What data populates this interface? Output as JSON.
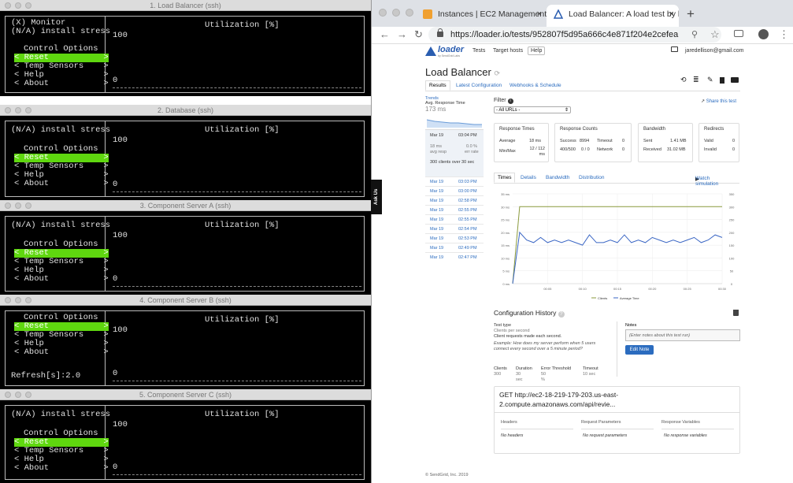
{
  "terminals": [
    {
      "title": "1. Load Balancer (ssh)",
      "lines": [
        "(X) Monitor",
        "(N/A) install stress"
      ],
      "util_header": "Utilization [%]",
      "top": "100",
      "bottom": "0",
      "refresh": "",
      "controls": {
        "header": "Control Options",
        "reset": "< Reset           >",
        "temp": "< Temp Sensors    >",
        "help": "< Help            >",
        "about": "< About           >"
      }
    },
    {
      "title": "2. Database (ssh)",
      "lines": [
        "(N/A) install stress"
      ],
      "util_header": "Utilization [%]",
      "top": "100",
      "bottom": "0",
      "refresh": "",
      "controls": {
        "header": "Control Options",
        "reset": "< Reset           >",
        "temp": "< Temp Sensors    >",
        "help": "< Help            >",
        "about": "< About           >"
      }
    },
    {
      "title": "3. Component Server A (ssh)",
      "lines": [
        "(N/A) install stress"
      ],
      "util_header": "Utilization [%]",
      "top": "100",
      "bottom": "0",
      "refresh": "",
      "controls": {
        "header": "Control Options",
        "reset": "< Reset           >",
        "temp": "< Temp Sensors    >",
        "help": "< Help            >",
        "about": "< About           >"
      }
    },
    {
      "title": "4. Component Server B (ssh)",
      "lines": [],
      "util_header": "Utilization [%]",
      "top": "100",
      "bottom": "0",
      "refresh": "Refresh[s]:2.0",
      "controls": {
        "header": "Control Options",
        "reset": "< Reset           >",
        "temp": "< Temp Sensors    >",
        "help": "< Help            >",
        "about": "< About           >"
      }
    },
    {
      "title": "5. Component Server C (ssh)",
      "lines": [
        "(N/A) install stress"
      ],
      "util_header": "Utilization [%]",
      "top": "100",
      "bottom": "0",
      "refresh": "",
      "controls": {
        "header": "Control Options",
        "reset": "< Reset           >",
        "temp": "< Temp Sensors    >",
        "help": "< Help            >",
        "about": "< About           >"
      }
    }
  ],
  "browser": {
    "tabs": [
      {
        "label": "Instances | EC2 Management C",
        "close": "×"
      },
      {
        "label": "Load Balancer: A load test by l",
        "close": "×"
      }
    ],
    "new_tab": "+",
    "url": "https://loader.io/tests/952807f5d95a666c4e871f204e2cefea"
  },
  "page": {
    "logo": "loader",
    "logo_sub": "by SendGrid Labs",
    "nav": [
      "Tests",
      "Target hosts"
    ],
    "help": "Help",
    "account": "jaredellison@gmail.com",
    "title": "Load Balancer",
    "tabs": [
      "Results",
      "Latest Configuration",
      "Webhooks & Schedule"
    ],
    "trends_label": "Trends",
    "trends_metric": "Avg. Response Time",
    "trends_value": "173 ms",
    "current_run": {
      "date": "Mar 19",
      "time": "03:04 PM",
      "avg": "18 ms",
      "avg_label": "avg resp",
      "err": "0.0 %",
      "err_label": "err rate",
      "clients": "300 clients over 30 sec"
    },
    "runs": [
      [
        "Mar 19",
        "03:03 PM"
      ],
      [
        "Mar 19",
        "03:00 PM"
      ],
      [
        "Mar 19",
        "02:58 PM"
      ],
      [
        "Mar 19",
        "02:55 PM"
      ],
      [
        "Mar 19",
        "02:55 PM"
      ],
      [
        "Mar 19",
        "02:54 PM"
      ],
      [
        "Mar 19",
        "02:53 PM"
      ],
      [
        "Mar 19",
        "02:49 PM"
      ],
      [
        "Mar 19",
        "02:47 PM"
      ]
    ],
    "filter_label": "Filter",
    "filter_value": "- All URLs -",
    "share": "Share this test",
    "response_times": {
      "title": "Response Times",
      "avg_label": "Average",
      "avg": "18 ms",
      "minmax_label": "Min/Max",
      "minmax": "12 / 112 ms"
    },
    "response_counts": {
      "title": "Response Counts",
      "success_label": "Success",
      "success": "8994",
      "timeout_label": "Timeout",
      "timeout": "0",
      "r400_label": "400/500",
      "r400": "0 / 0",
      "network_label": "Network",
      "network": "0"
    },
    "bandwidth": {
      "title": "Bandwidth",
      "sent_label": "Sent",
      "sent": "1.41 MB",
      "recv_label": "Received",
      "recv": "31.02 MB"
    },
    "redirects": {
      "title": "Redirects",
      "valid_label": "Valid",
      "valid": "0",
      "invalid_label": "Invalid",
      "invalid": "0"
    },
    "chart_tabs": [
      "Times",
      "Details",
      "Bandwidth",
      "Distribution"
    ],
    "watch": "Watch simulation",
    "config": {
      "title": "Configuration History",
      "test_type_label": "Test type",
      "test_type": "Clients per second",
      "test_desc": "Client requests made each second.",
      "example": "Example: How does my server perform when 5 users connect every second over a 5 minute period?",
      "clients_label": "Clients",
      "clients": "300",
      "duration_label": "Duration",
      "duration": "30 sec",
      "error_label": "Error Threshold",
      "error": "50 %",
      "timeout_label": "Timeout",
      "timeout": "10 sec",
      "notes_label": "Notes",
      "notes_placeholder": "(Enter notes about this test run)",
      "edit_note": "Edit Note",
      "request": "GET http://ec2-18-219-179-203.us-east-2.compute.amazonaws.com/api/revie...",
      "headers": "Headers",
      "no_headers": "No headers",
      "req_params": "Request Parameters",
      "no_req_params": "No request parameters",
      "resp_vars": "Response Variables",
      "no_resp_vars": "No response variables"
    },
    "footer": "© SendGrid, Inc. 2019",
    "ask": "Ask Us"
  },
  "chart_data": {
    "type": "line",
    "x": [
      0,
      1,
      2,
      3,
      4,
      5,
      6,
      7,
      8,
      9,
      10,
      11,
      12,
      13,
      14,
      15,
      16,
      17,
      18,
      19,
      20,
      21,
      22,
      23,
      24,
      25,
      26,
      27,
      28,
      29,
      30
    ],
    "x_tick_labels": [
      "00:05",
      "00:10",
      "00:15",
      "00:20",
      "00:25",
      "00:30"
    ],
    "series": [
      {
        "name": "Clients",
        "axis": "right",
        "color": "#8a9a3c",
        "values": [
          0,
          300,
          300,
          300,
          300,
          300,
          300,
          300,
          300,
          300,
          300,
          300,
          300,
          300,
          300,
          300,
          300,
          300,
          300,
          300,
          300,
          300,
          300,
          300,
          300,
          300,
          300,
          300,
          300,
          300,
          300
        ]
      },
      {
        "name": "Average Time",
        "axis": "left",
        "color": "#3a66c4",
        "values": [
          0,
          20,
          17,
          16,
          18,
          16,
          17,
          16,
          17,
          16,
          15,
          19,
          16,
          16,
          17,
          16,
          19,
          16,
          17,
          16,
          18,
          17,
          16,
          17,
          16,
          17,
          18,
          16,
          17,
          19,
          18
        ]
      }
    ],
    "y_left": {
      "ylim": [
        0,
        35
      ],
      "ticks": [
        "0 ms",
        "5 ms",
        "10 ms",
        "15 ms",
        "20 ms",
        "25 ms",
        "30 ms",
        "35 ms"
      ]
    },
    "y_right": {
      "ylim": [
        0,
        350
      ],
      "ticks": [
        "0",
        "50",
        "100",
        "150",
        "200",
        "250",
        "300",
        "350"
      ]
    }
  }
}
